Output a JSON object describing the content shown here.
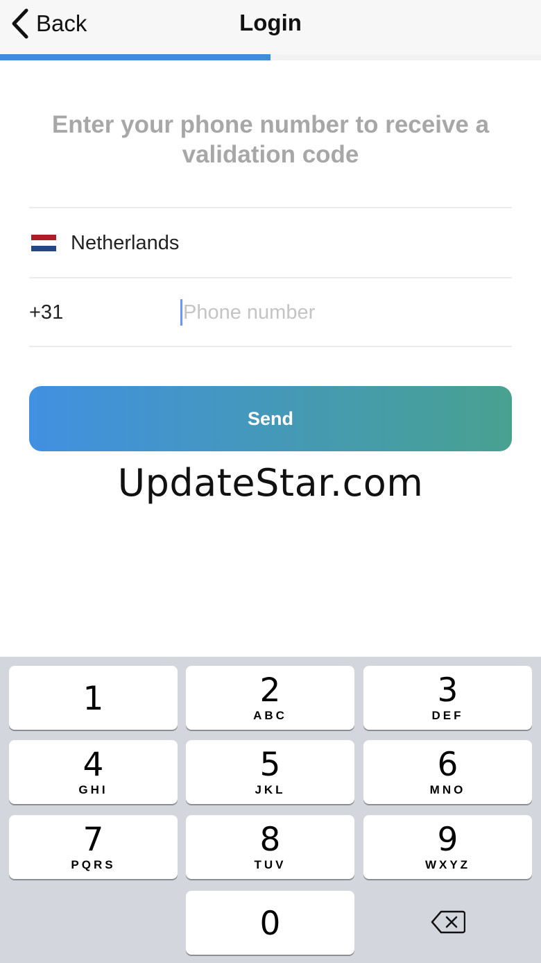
{
  "navbar": {
    "back_label": "Back",
    "title": "Login",
    "progress_fraction": 0.5,
    "progress_color": "#3e8dd6"
  },
  "form": {
    "instruction": "Enter your phone number to receive a validation code",
    "country_name": "Netherlands",
    "country_flag_icon": "netherlands-flag-icon",
    "dial_code": "+31",
    "phone_value": "",
    "phone_placeholder": "Phone number",
    "send_label": "Send",
    "send_gradient": [
      "#4190e2",
      "#48a190"
    ]
  },
  "watermark": "UpdateStar.com",
  "keypad": {
    "keys": [
      {
        "digit": "1",
        "letters": ""
      },
      {
        "digit": "2",
        "letters": "ABC"
      },
      {
        "digit": "3",
        "letters": "DEF"
      },
      {
        "digit": "4",
        "letters": "GHI"
      },
      {
        "digit": "5",
        "letters": "JKL"
      },
      {
        "digit": "6",
        "letters": "MNO"
      },
      {
        "digit": "7",
        "letters": "PQRS"
      },
      {
        "digit": "8",
        "letters": "TUV"
      },
      {
        "digit": "9",
        "letters": "WXYZ"
      },
      {
        "digit": "0",
        "letters": ""
      }
    ],
    "delete_icon": "backspace-icon"
  }
}
